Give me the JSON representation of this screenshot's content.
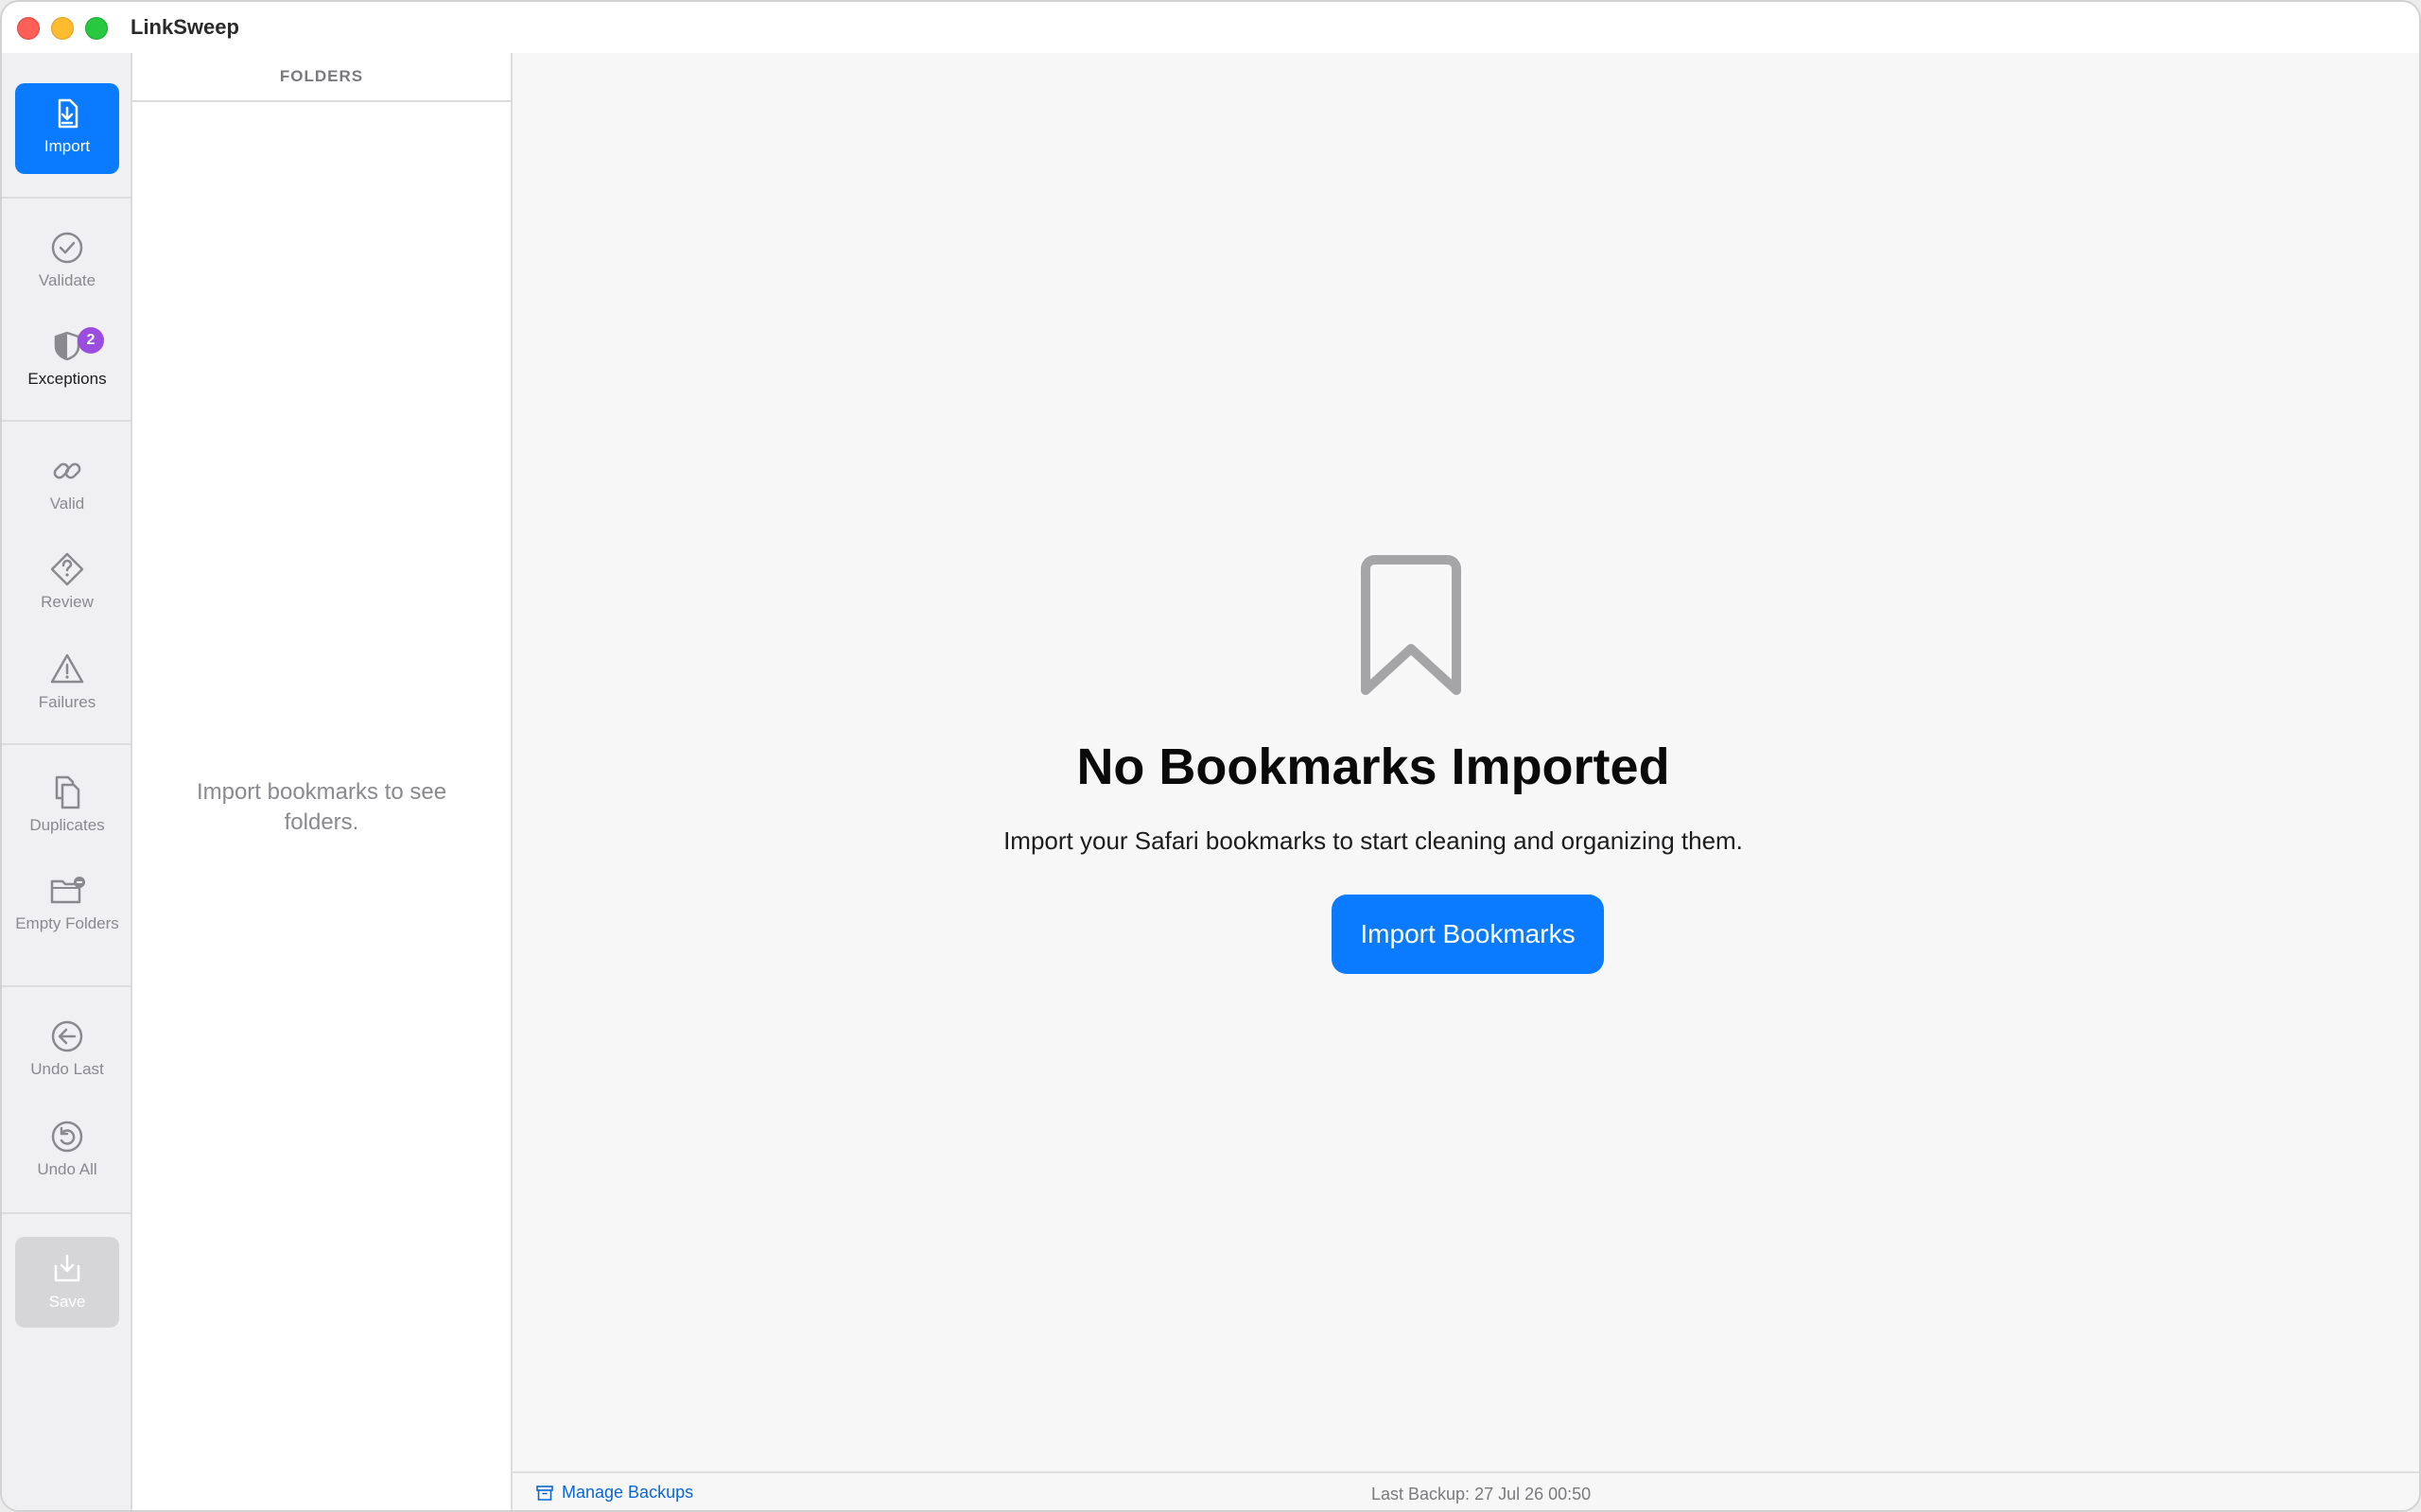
{
  "window": {
    "title": "LinkSweep"
  },
  "nav": {
    "import": "Import",
    "validate": "Validate",
    "exceptions": "Exceptions",
    "exceptions_badge": "2",
    "valid": "Valid",
    "review": "Review",
    "failures": "Failures",
    "duplicates": "Duplicates",
    "empty_folders": "Empty Folders",
    "undo_last": "Undo Last",
    "undo_all": "Undo All",
    "save": "Save"
  },
  "folders": {
    "header": "FOLDERS",
    "empty_text": "Import bookmarks to see folders."
  },
  "main": {
    "empty_icon": "bookmark-icon",
    "title": "No Bookmarks Imported",
    "subtitle": "Import your Safari bookmarks to start cleaning and organizing them.",
    "button": "Import Bookmarks"
  },
  "status": {
    "manage_backups": "Manage Backups",
    "last_backup": "Last Backup: 27 Jul 26 00:50"
  },
  "colors": {
    "accent": "#0a7aff",
    "badge": "#9b4de0",
    "close": "#ff5f57",
    "minimize": "#febc2e",
    "maximize": "#28c840"
  }
}
